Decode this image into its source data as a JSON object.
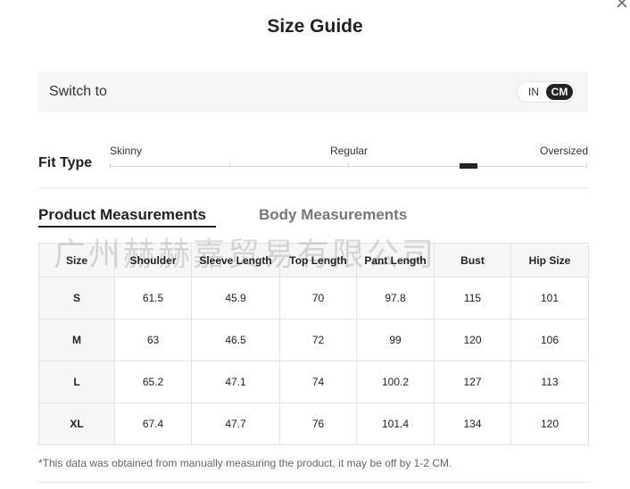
{
  "dialog": {
    "title": "Size Guide",
    "close_icon": "close-icon"
  },
  "switch": {
    "label": "Switch to",
    "unit_in": "IN",
    "unit_cm": "CM",
    "selected": "CM"
  },
  "fit": {
    "label": "Fit Type",
    "skinny": "Skinny",
    "regular": "Regular",
    "oversized": "Oversized"
  },
  "tabs": {
    "product": "Product Measurements",
    "body": "Body Measurements",
    "active": "product"
  },
  "watermark": "广州赫赫嘉贸易有限公司",
  "table": {
    "headers": [
      "Size",
      "Shoulder",
      "Sleeve Length",
      "Top Length",
      "Pant Length",
      "Bust",
      "Hip Size"
    ],
    "rows": [
      [
        "S",
        "61.5",
        "45.9",
        "70",
        "97.8",
        "115",
        "101"
      ],
      [
        "M",
        "63",
        "46.5",
        "72",
        "99",
        "120",
        "106"
      ],
      [
        "L",
        "65.2",
        "47.1",
        "74",
        "100.2",
        "127",
        "113"
      ],
      [
        "XL",
        "67.4",
        "47.7",
        "76",
        "101.4",
        "134",
        "120"
      ]
    ]
  },
  "note": "*This data was obtained from manually measuring the product, it may be off by 1-2 CM.",
  "colors": {
    "accent": "#222222",
    "panel_bg": "#f6f6f6",
    "border": "#e3e3e3"
  }
}
